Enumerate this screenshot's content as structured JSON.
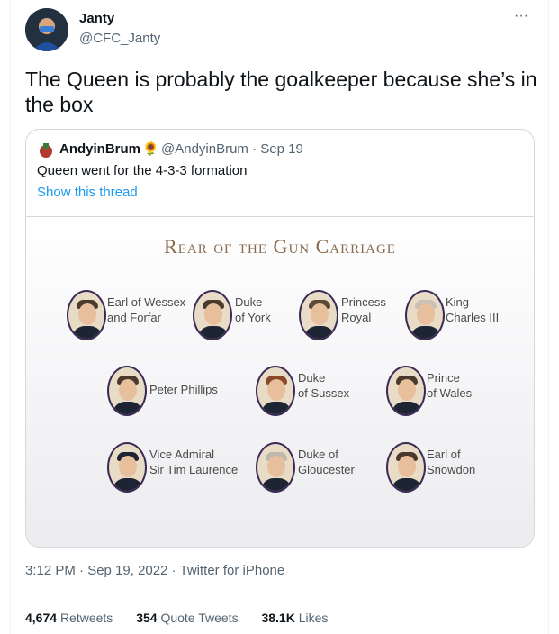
{
  "author": {
    "name": "Janty",
    "handle": "@CFC_Janty"
  },
  "more_icon": "more-horizontal-icon",
  "tweet_text": "The Queen is probably the goalkeeper because she’s in the box",
  "quote": {
    "name": "AndyinBrum",
    "emoji": "🌻",
    "handle_date": "@AndyinBrum · Sep 19",
    "text": "Queen went for the 4-3-3 formation",
    "link": "Show this thread",
    "image": {
      "title": "Rear of the Gun Carriage",
      "people": [
        {
          "l1": "Earl of Wessex",
          "l2": "and Forfar"
        },
        {
          "l1": "Duke",
          "l2": "of York"
        },
        {
          "l1": "Princess",
          "l2": "Royal"
        },
        {
          "l1": "King",
          "l2": "Charles III"
        },
        {
          "l1": "Peter Phillips",
          "l2": ""
        },
        {
          "l1": "Duke",
          "l2": "of Sussex"
        },
        {
          "l1": "Prince",
          "l2": "of Wales"
        },
        {
          "l1": "Vice Admiral",
          "l2": "Sir Tim Laurence"
        },
        {
          "l1": "Duke of",
          "l2": "Gloucester"
        },
        {
          "l1": "Earl of",
          "l2": "Snowdon"
        }
      ]
    }
  },
  "timestamp": "3:12 PM · Sep 19, 2022 · Twitter for iPhone",
  "stats": {
    "retweets_count": "4,674",
    "retweets_label": "Retweets",
    "quotes_count": "354",
    "quotes_label": "Quote Tweets",
    "likes_count": "38.1K",
    "likes_label": "Likes"
  },
  "colors": {
    "accent": "#1d9bf0",
    "muted": "#536471",
    "border": "#cfd9de"
  }
}
